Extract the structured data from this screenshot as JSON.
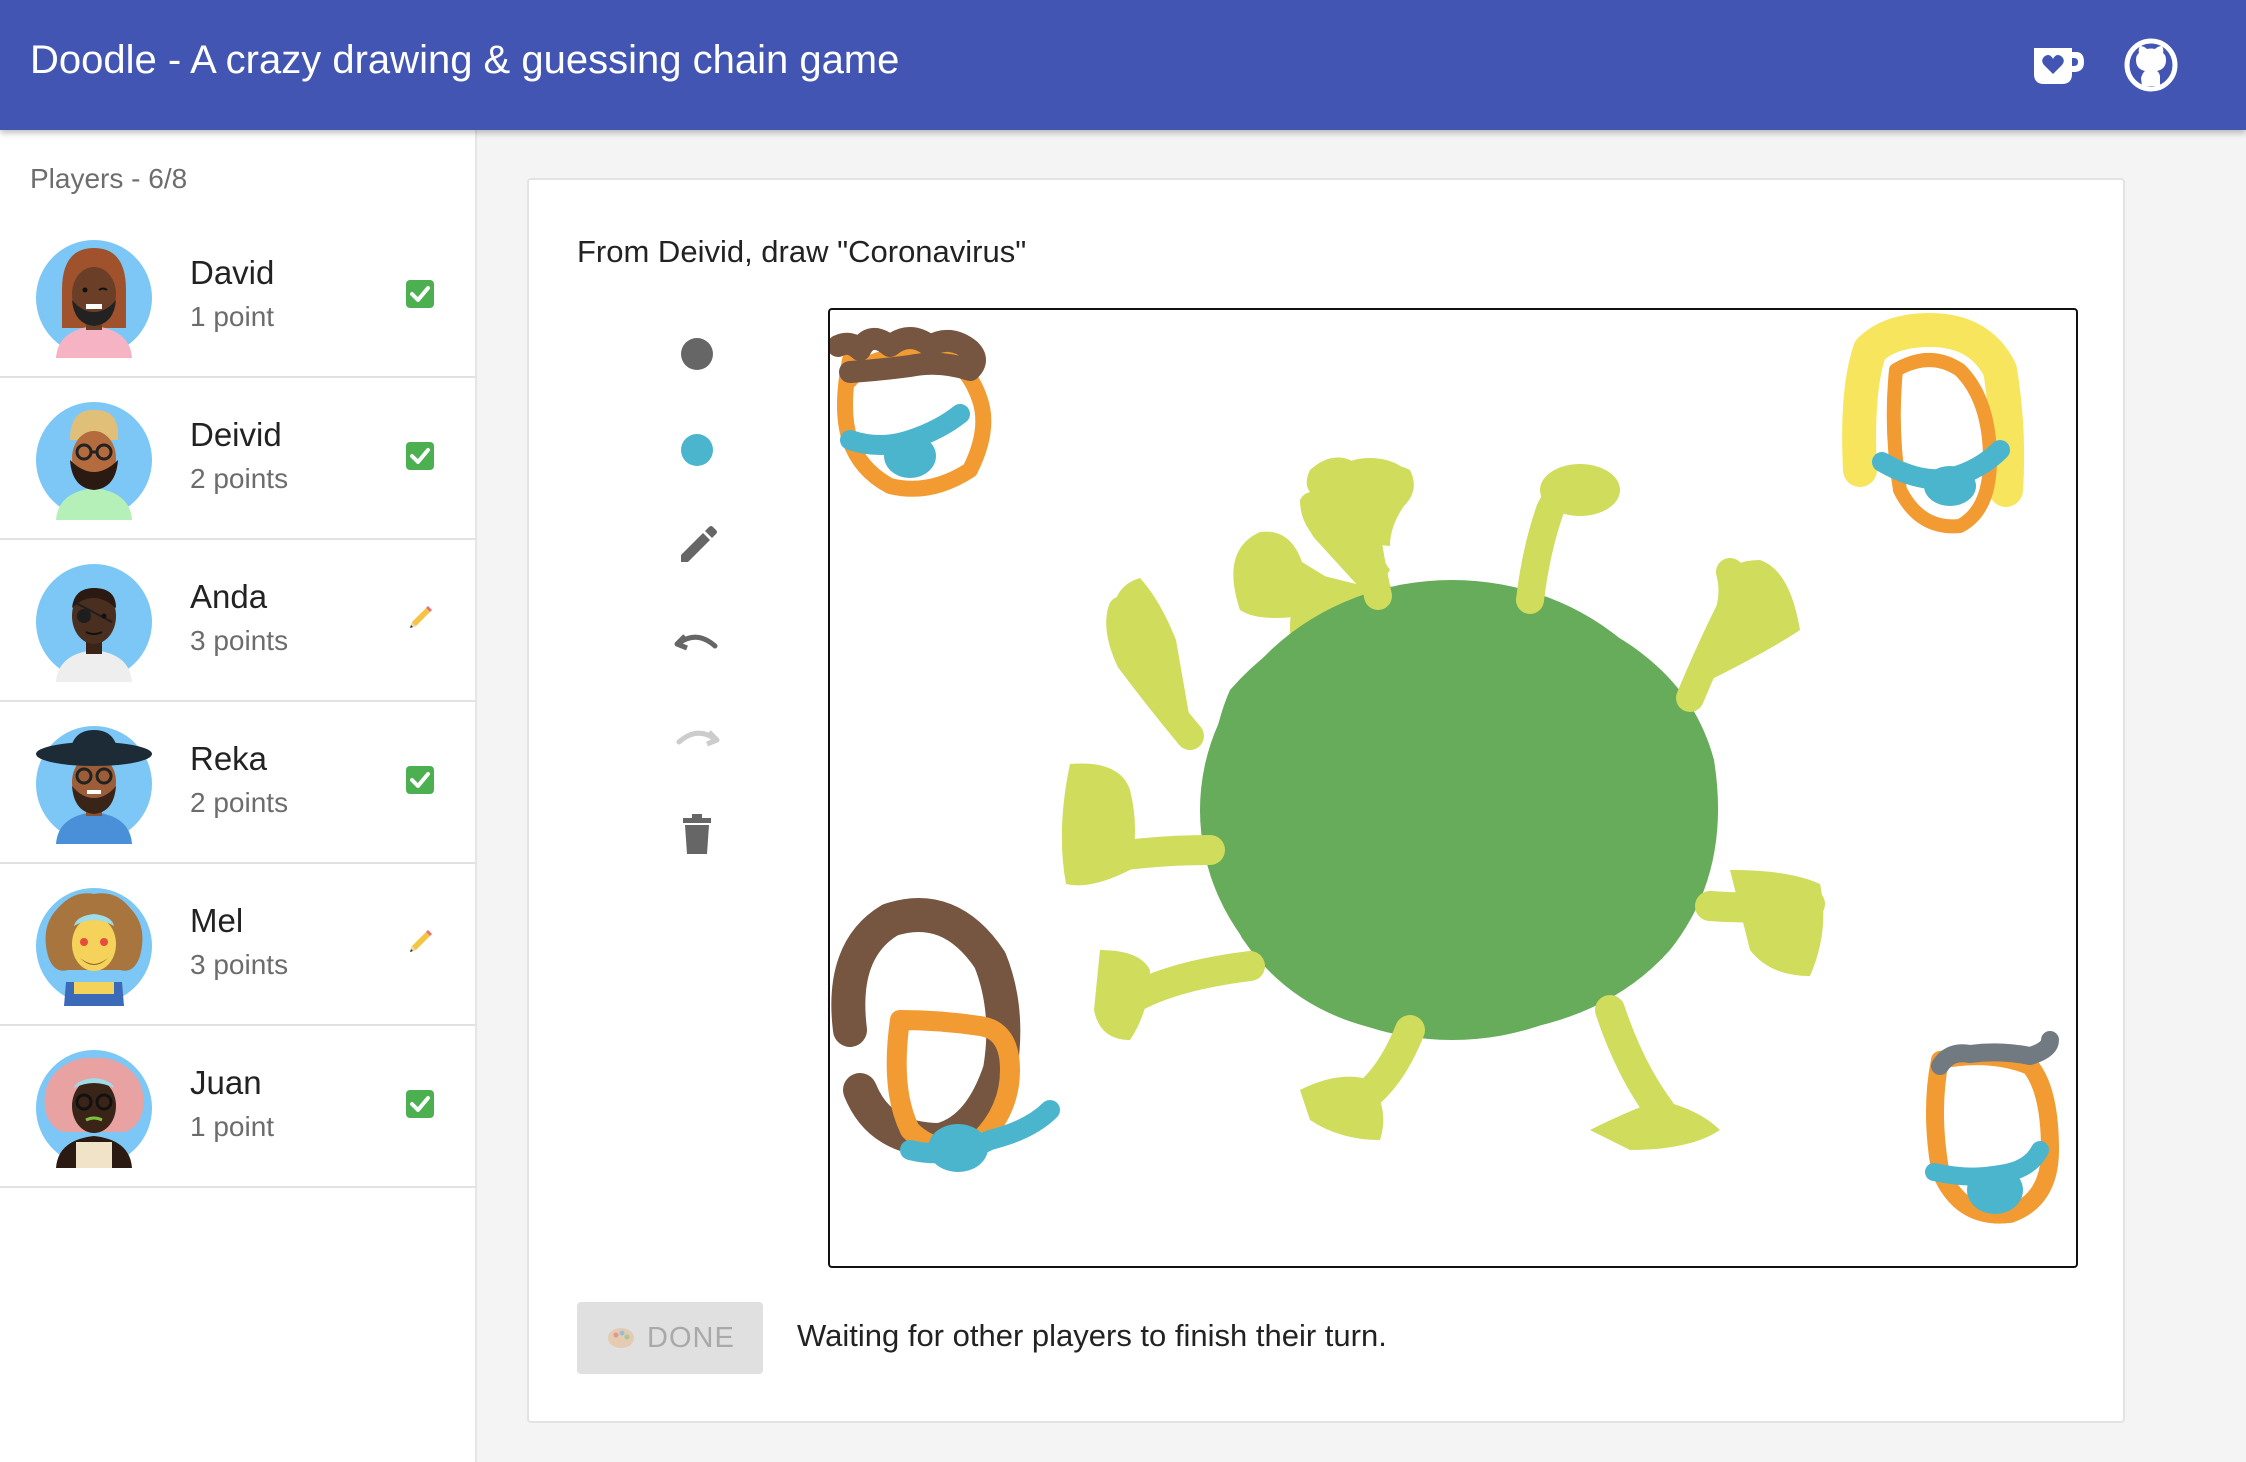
{
  "header": {
    "title": "Doodle - A crazy drawing & guessing chain game",
    "color": "#4255b3",
    "icons": [
      "kofi-cup-icon",
      "github-icon"
    ]
  },
  "sidebar": {
    "players_header": "Players - 6/8",
    "players": [
      {
        "name": "David",
        "points": "1 point",
        "status": "done"
      },
      {
        "name": "Deivid",
        "points": "2 points",
        "status": "done"
      },
      {
        "name": "Anda",
        "points": "3 points",
        "status": "drawing"
      },
      {
        "name": "Reka",
        "points": "2 points",
        "status": "done"
      },
      {
        "name": "Mel",
        "points": "3 points",
        "status": "drawing"
      },
      {
        "name": "Juan",
        "points": "1 point",
        "status": "done"
      }
    ]
  },
  "game": {
    "prompt": "From Deivid, draw \"Coronavirus\"",
    "tools": [
      "brush-size-large",
      "color-picker",
      "pencil-icon",
      "undo-icon",
      "redo-icon",
      "trash-icon"
    ],
    "selected_color": "#4bb5cd",
    "done_label": "DONE",
    "waiting_text": "Waiting for other players to finish their turn."
  }
}
